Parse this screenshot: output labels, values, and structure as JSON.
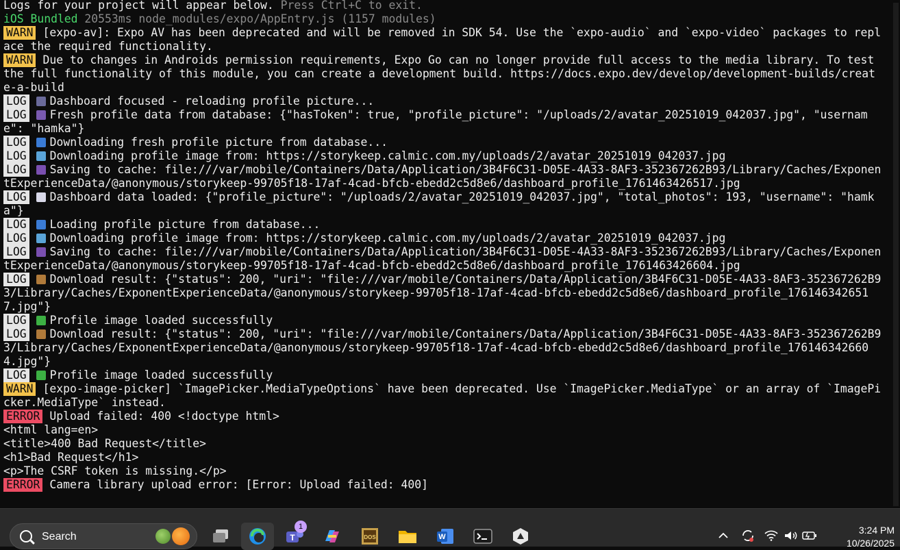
{
  "terminal": {
    "lines": [
      {
        "type": "plain",
        "text": "Logs for your project will appear below.",
        "dim_text": " Press Ctrl+C to exit."
      },
      {
        "type": "bundled",
        "label": "iOS Bundled",
        "text": " 20553ms node_modules/expo/AppEntry.js (1157 modules)"
      },
      {
        "type": "badge",
        "badge": "WARN",
        "kind": "warn",
        "text": "[expo-av]: Expo AV has been deprecated and will be removed in SDK 54. Use the `expo-audio` and `expo-video` packages to replace the required functionality."
      },
      {
        "type": "badge",
        "badge": "WARN",
        "kind": "warn",
        "text": "Due to changes in Androids permission requirements, Expo Go can no longer provide full access to the media library. To test the full functionality of this module, you can create a development build. https://docs.expo.dev/develop/development-builds/create-a-build"
      },
      {
        "type": "badge",
        "badge": "LOG",
        "kind": "log",
        "icon": "phone",
        "text": "Dashboard focused - reloading profile picture..."
      },
      {
        "type": "badge",
        "badge": "LOG",
        "kind": "log",
        "icon": "person",
        "text": "Fresh profile data from database: {\"hasToken\": true, \"profile_picture\": \"/uploads/2/avatar_20251019_042037.jpg\", \"username\": \"hamka\"}"
      },
      {
        "type": "badge",
        "badge": "LOG",
        "kind": "log",
        "icon": "inbox",
        "text": "Downloading fresh profile picture from database..."
      },
      {
        "type": "badge",
        "badge": "LOG",
        "kind": "log",
        "icon": "picture",
        "text": "Downloading profile image from: https://storykeep.calmic.com.my/uploads/2/avatar_20251019_042037.jpg"
      },
      {
        "type": "badge",
        "badge": "LOG",
        "kind": "log",
        "icon": "floppy",
        "text": "Saving to cache: file:///var/mobile/Containers/Data/Application/3B4F6C31-D05E-4A33-8AF3-352367262B93/Library/Caches/ExponentExperienceData/@anonymous/storykeep-99705f18-17af-4cad-bfcb-ebedd2c5d8e6/dashboard_profile_1761463426517.jpg"
      },
      {
        "type": "badge",
        "badge": "LOG",
        "kind": "log",
        "icon": "chart",
        "text": "Dashboard data loaded: {\"profile_picture\": \"/uploads/2/avatar_20251019_042037.jpg\", \"total_photos\": 193, \"username\": \"hamka\"}"
      },
      {
        "type": "badge",
        "badge": "LOG",
        "kind": "log",
        "icon": "inbox",
        "text": "Loading profile picture from database..."
      },
      {
        "type": "badge",
        "badge": "LOG",
        "kind": "log",
        "icon": "picture",
        "text": "Downloading profile image from: https://storykeep.calmic.com.my/uploads/2/avatar_20251019_042037.jpg"
      },
      {
        "type": "badge",
        "badge": "LOG",
        "kind": "log",
        "icon": "floppy",
        "text": "Saving to cache: file:///var/mobile/Containers/Data/Application/3B4F6C31-D05E-4A33-8AF3-352367262B93/Library/Caches/ExponentExperienceData/@anonymous/storykeep-99705f18-17af-4cad-bfcb-ebedd2c5d8e6/dashboard_profile_1761463426604.jpg"
      },
      {
        "type": "badge",
        "badge": "LOG",
        "kind": "log",
        "icon": "package",
        "text": "Download result: {\"status\": 200, \"uri\": \"file:///var/mobile/Containers/Data/Application/3B4F6C31-D05E-4A33-8AF3-352367262B93/Library/Caches/ExponentExperienceData/@anonymous/storykeep-99705f18-17af-4cad-bfcb-ebedd2c5d8e6/dashboard_profile_1761463426517.jpg\"}"
      },
      {
        "type": "badge",
        "badge": "LOG",
        "kind": "log",
        "icon": "check",
        "text": "Profile image loaded successfully"
      },
      {
        "type": "badge",
        "badge": "LOG",
        "kind": "log",
        "icon": "package",
        "text": "Download result: {\"status\": 200, \"uri\": \"file:///var/mobile/Containers/Data/Application/3B4F6C31-D05E-4A33-8AF3-352367262B93/Library/Caches/ExponentExperienceData/@anonymous/storykeep-99705f18-17af-4cad-bfcb-ebedd2c5d8e6/dashboard_profile_1761463426604.jpg\"}"
      },
      {
        "type": "badge",
        "badge": "LOG",
        "kind": "log",
        "icon": "check",
        "text": "Profile image loaded successfully"
      },
      {
        "type": "badge",
        "badge": "WARN",
        "kind": "warn",
        "text": "[expo-image-picker] `ImagePicker.MediaTypeOptions` have been deprecated. Use `ImagePicker.MediaType` or an array of `ImagePicker.MediaType` instead."
      },
      {
        "type": "badge",
        "badge": "ERROR",
        "kind": "error",
        "text": "Upload failed: 400 <!doctype html>"
      },
      {
        "type": "plain",
        "text": "<html lang=en>"
      },
      {
        "type": "plain",
        "text": "<title>400 Bad Request</title>"
      },
      {
        "type": "plain",
        "text": "<h1>Bad Request</h1>"
      },
      {
        "type": "plain",
        "text": "<p>The CSRF token is missing.</p>"
      },
      {
        "type": "badge",
        "badge": "ERROR",
        "kind": "error",
        "text": "Camera library upload error: [Error: Upload failed: 400]"
      }
    ]
  },
  "icon_colors": {
    "phone": "#6a6a9a",
    "person": "#7a5ab0",
    "inbox": "#3a7bd5",
    "picture": "#5aa4d8",
    "floppy": "#7a4fb0",
    "chart": "#d8d8e8",
    "package": "#b07a3a",
    "check": "#3cb043"
  },
  "taskbar": {
    "search_label": "Search",
    "apps": [
      {
        "name": "task-view-icon",
        "active": false
      },
      {
        "name": "edge-icon",
        "active": true
      },
      {
        "name": "teams-icon",
        "active": false,
        "badge": "1"
      },
      {
        "name": "copilot-icon",
        "active": false
      },
      {
        "name": "dosbox-icon",
        "active": false
      },
      {
        "name": "file-explorer-icon",
        "active": false
      },
      {
        "name": "word-icon",
        "active": false
      },
      {
        "name": "terminal-icon",
        "active": false
      },
      {
        "name": "app-icon",
        "active": false
      }
    ],
    "time": "3:24 PM",
    "date": "10/26/2025"
  }
}
